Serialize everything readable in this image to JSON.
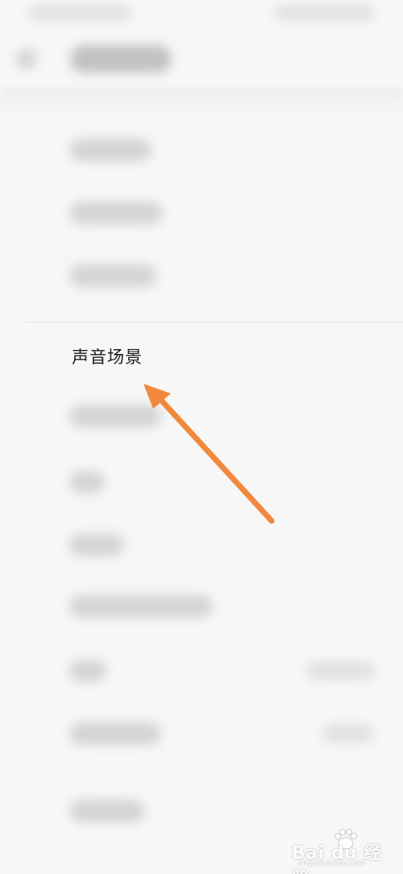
{
  "screen": {
    "focused_setting_label": "声音场景",
    "accent_color": "#f0893c"
  },
  "icons": {
    "back": "back-arrow-icon",
    "pointer": "orange-arrow-icon",
    "watermark": "paw-icon"
  },
  "watermark": {
    "logo_text": "Bai du 经验",
    "url_text": "jingyan.baidu.com"
  }
}
